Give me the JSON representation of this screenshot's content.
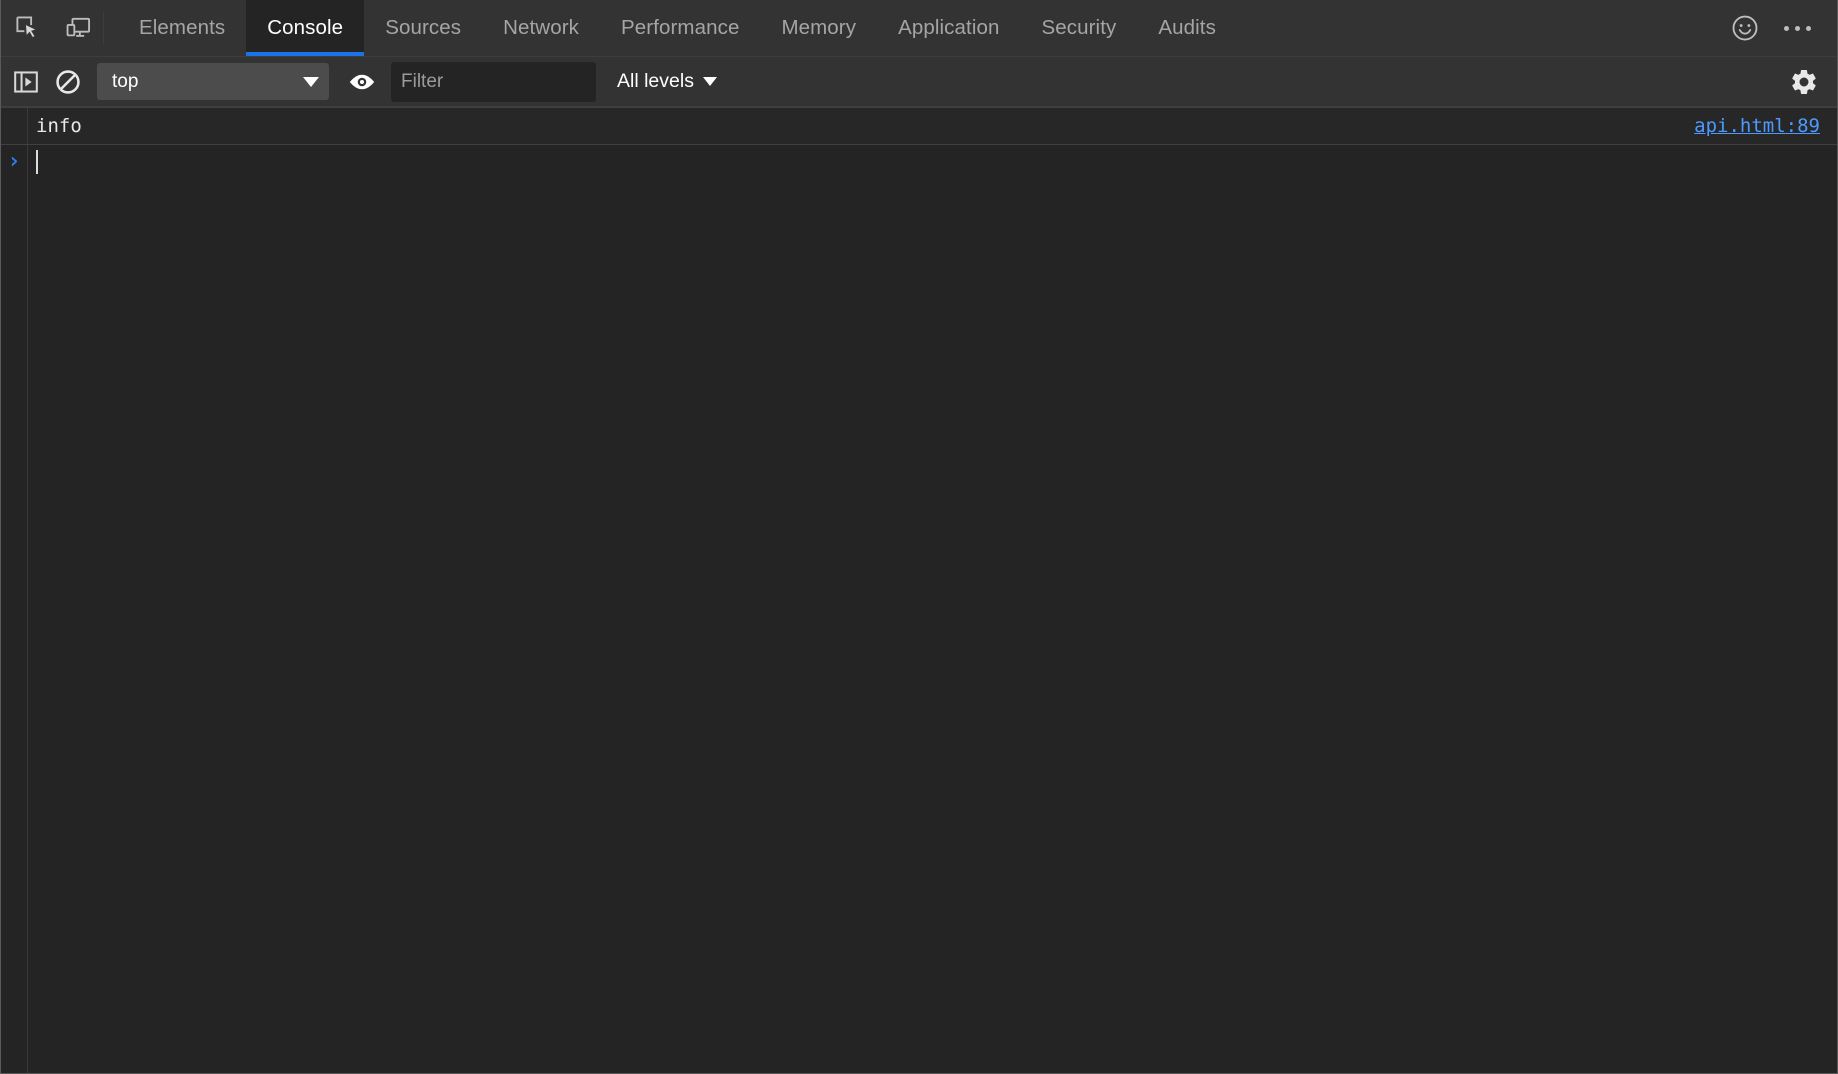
{
  "tabbar": {
    "inspect_icon": "inspect-cursor-icon",
    "device_icon": "device-toolbar-icon",
    "tabs": [
      {
        "label": "Elements",
        "active": false
      },
      {
        "label": "Console",
        "active": true
      },
      {
        "label": "Sources",
        "active": false
      },
      {
        "label": "Network",
        "active": false
      },
      {
        "label": "Performance",
        "active": false
      },
      {
        "label": "Memory",
        "active": false
      },
      {
        "label": "Application",
        "active": false
      },
      {
        "label": "Security",
        "active": false
      },
      {
        "label": "Audits",
        "active": false
      }
    ],
    "feedback_icon": "smiley-face-icon",
    "more_icon": "more-options-icon"
  },
  "console_toolbar": {
    "sidebar_toggle_icon": "console-sidebar-toggle-icon",
    "clear_icon": "clear-console-icon",
    "context": {
      "value": "top",
      "caret_icon": "chevron-down-icon"
    },
    "live_expression_icon": "eye-icon",
    "filter": {
      "value": "",
      "placeholder": "Filter"
    },
    "levels": {
      "label": "All levels",
      "caret_icon": "chevron-down-icon"
    },
    "settings_icon": "gear-icon"
  },
  "console": {
    "messages": [
      {
        "text": "info",
        "source": "api.html:89",
        "level": "info"
      }
    ],
    "prompt": {
      "chevron": "›",
      "value": ""
    }
  },
  "colors": {
    "accent": "#1a73e8",
    "link": "#4c9aff",
    "toolbar_bg": "#333333",
    "panel_bg": "#242424",
    "message_bg": "#272727",
    "text": "#e8e8e8",
    "muted_text": "#a5a5a5",
    "prompt_chevron": "#2f7fe8"
  }
}
